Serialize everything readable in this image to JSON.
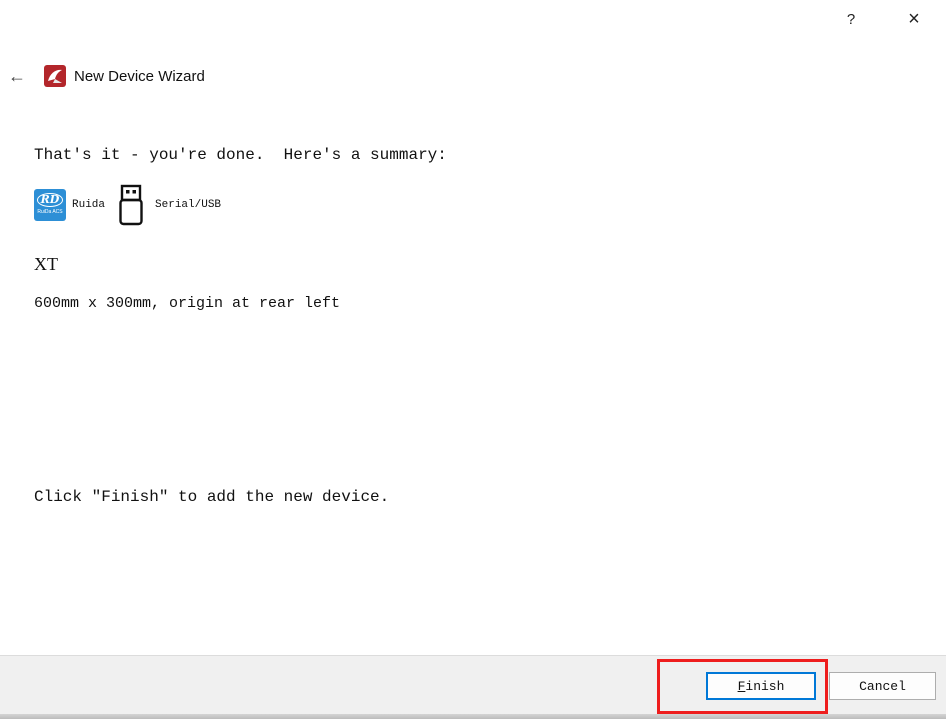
{
  "titlebar": {
    "help_label": "?",
    "close_label": "×"
  },
  "header": {
    "back_label": "←",
    "title": "New Device Wizard"
  },
  "summary": {
    "intro": "That's it - you're done.  Here's a summary:",
    "controller_label": "Ruida",
    "controller_logo_text": "RD",
    "controller_logo_sub": "RuiDa ACS",
    "connection_label": "Serial/USB",
    "device_name": "XT",
    "device_description": "600mm x 300mm, origin at rear left",
    "finish_hint": "Click \"Finish\" to add the new device."
  },
  "buttons": {
    "finish_label": "Finish",
    "cancel_label": "Cancel"
  },
  "colors": {
    "accent": "#0078d7",
    "highlight": "#ee1d1d",
    "ruida_blue": "#2d8fd6",
    "logo_red": "#b3262b"
  },
  "icons": {
    "back": "arrow-left-icon",
    "app": "lightburn-logo-icon",
    "controller": "ruida-logo-icon",
    "connection": "usb-drive-icon"
  }
}
